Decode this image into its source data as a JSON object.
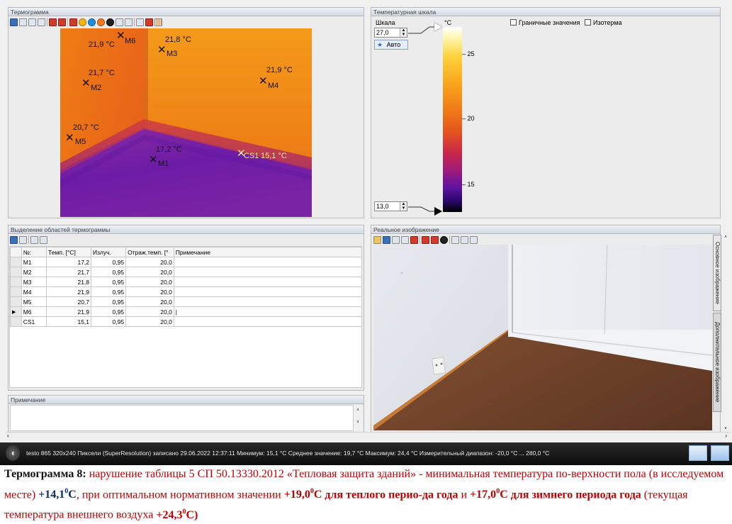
{
  "panels": {
    "thermogram_title": "Термограмма",
    "scale_title": "Температурная шкала",
    "regions_title": "Выделение областей термограммы",
    "note_title": "Примечание",
    "real_title": "Реальное изображение"
  },
  "thermogram_markers": [
    {
      "id": "M6",
      "temp": "21,9 °C"
    },
    {
      "id": "M3",
      "temp": "21,8 °C"
    },
    {
      "id": "M2",
      "temp": "21,7 °C"
    },
    {
      "id": "M4",
      "temp": "21,9 °C"
    },
    {
      "id": "M5",
      "temp": "20,7 °C"
    },
    {
      "id": "M1",
      "temp": "17,2 °C"
    },
    {
      "id": "CS1",
      "temp": "15,1 °C"
    }
  ],
  "scale": {
    "label": "Шкала",
    "unit": "°C",
    "max_value": "27,0",
    "min_value": "13,0",
    "auto_label": "Авто",
    "boundary_values_label": "Граничные значения",
    "isotherm_label": "Изотерма",
    "ticks": [
      "25",
      "20",
      "15"
    ]
  },
  "regions_table": {
    "headers": [
      "№:",
      "Темп. [°C]",
      "Излуч.",
      "Отраж.темп. [°",
      "Примечание"
    ],
    "rows": [
      [
        "M1",
        "17,2",
        "0,95",
        "20,0",
        ""
      ],
      [
        "M2",
        "21,7",
        "0,95",
        "20,0",
        ""
      ],
      [
        "M3",
        "21,8",
        "0,95",
        "20,0",
        ""
      ],
      [
        "M4",
        "21,9",
        "0,95",
        "20,0",
        ""
      ],
      [
        "M5",
        "20,7",
        "0,95",
        "20,0",
        ""
      ],
      [
        "M6",
        "21,9",
        "0,95",
        "20,0",
        "|"
      ],
      [
        "CS1",
        "15,1",
        "0,95",
        "20,0",
        ""
      ]
    ]
  },
  "side_tabs": [
    "Основное изображение",
    "Дополнительное изображение"
  ],
  "status": {
    "text": "testo 865 320x240 Пиксели (SuperResolution) записано 29.06.2022 12:37:11 Минимум: 15,1 °C Среднее значение: 19,7 °C Максимум: 24,4 °C Измерительный диапазон: -20,0 °C ... 280,0 °C"
  },
  "caption": {
    "lead": "Термограмма  8:",
    "part1": " нарушение таблицы 5 СП 50.13330.2012 «Тепловая защита зданий» - минимальная температура по-верхности пола (в исследуемом месте) ",
    "v1": "+14,1",
    "v1u": "0",
    "v1c": "С",
    "part2": ", при оптимальном нормативном значении ",
    "v2": "+19,0",
    "v2u": "0",
    "v2c": "С",
    "part3": " для теплого перио-да года",
    "part4": " и ",
    "v3": "+17,0",
    "v3u": "0",
    "v3c": "С",
    "part5": " для зимнего периода года",
    "part6": " (текущая температура внешнего воздуха ",
    "v4": "+24,3",
    "v4u": "0",
    "v4c": "С)"
  },
  "colors": {
    "accent_caption": "#c00000",
    "caption_value": "#0d2b6a",
    "thermal_warm": "#f08a14",
    "thermal_cold": "#6a1aa8"
  }
}
